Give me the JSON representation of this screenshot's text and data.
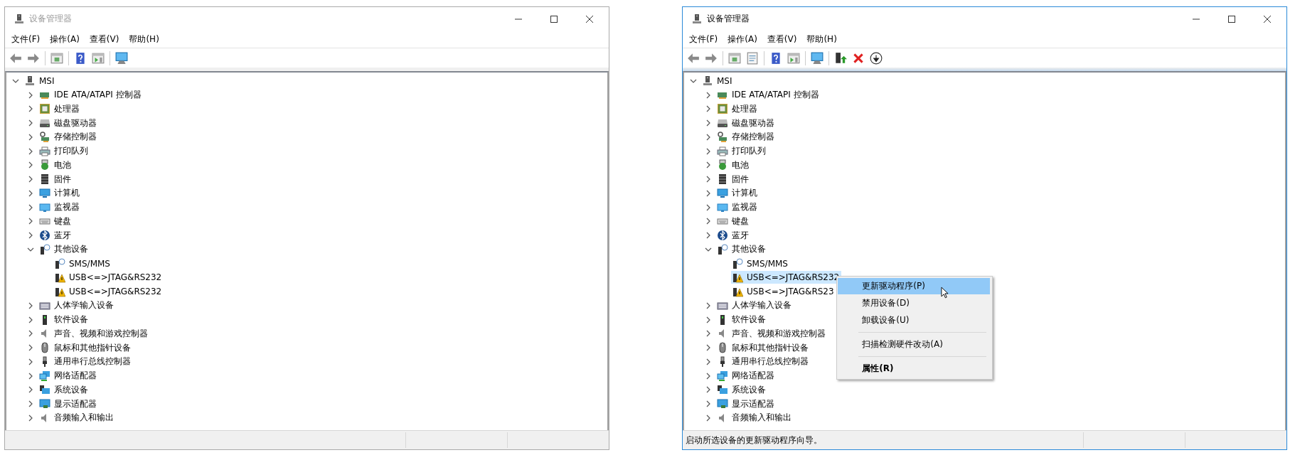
{
  "windows": [
    {
      "title": "设备管理器",
      "active": false,
      "menu": [
        "文件(F)",
        "操作(A)",
        "查看(V)",
        "帮助(H)"
      ],
      "toolbar": [
        {
          "kind": "back"
        },
        {
          "kind": "forward"
        },
        {
          "kind": "separator"
        },
        {
          "kind": "console"
        },
        {
          "kind": "separator"
        },
        {
          "kind": "help"
        },
        {
          "kind": "pane"
        },
        {
          "kind": "separator"
        },
        {
          "kind": "scan"
        }
      ],
      "tree": {
        "label": "MSI",
        "kind": "computer",
        "expanded": true,
        "selected": false,
        "children": [
          {
            "label": "IDE ATA/ATAPI 控制器",
            "kind": "ide",
            "expanded": false,
            "selected": false
          },
          {
            "label": "处理器",
            "kind": "cpu",
            "expanded": false,
            "selected": false
          },
          {
            "label": "磁盘驱动器",
            "kind": "disk",
            "expanded": false,
            "selected": false
          },
          {
            "label": "存储控制器",
            "kind": "storage",
            "expanded": false,
            "selected": false
          },
          {
            "label": "打印队列",
            "kind": "printer",
            "expanded": false,
            "selected": false
          },
          {
            "label": "电池",
            "kind": "battery",
            "expanded": false,
            "selected": false
          },
          {
            "label": "固件",
            "kind": "firmware",
            "expanded": false,
            "selected": false
          },
          {
            "label": "计算机",
            "kind": "pc",
            "expanded": false,
            "selected": false
          },
          {
            "label": "监视器",
            "kind": "monitor",
            "expanded": false,
            "selected": false
          },
          {
            "label": "键盘",
            "kind": "keyboard",
            "expanded": false,
            "selected": false
          },
          {
            "label": "蓝牙",
            "kind": "bluetooth",
            "expanded": false,
            "selected": false
          },
          {
            "label": "其他设备",
            "kind": "unknown",
            "expanded": true,
            "selected": false,
            "children": [
              {
                "label": "SMS/MMS",
                "kind": "unknown",
                "selected": false
              },
              {
                "label": "USB<=>JTAG&RS232",
                "kind": "warning",
                "selected": false
              },
              {
                "label": "USB<=>JTAG&RS232",
                "kind": "warning",
                "selected": false
              }
            ]
          },
          {
            "label": "人体学输入设备",
            "kind": "hid",
            "expanded": false,
            "selected": false
          },
          {
            "label": "软件设备",
            "kind": "software",
            "expanded": false,
            "selected": false
          },
          {
            "label": "声音、视频和游戏控制器",
            "kind": "sound",
            "expanded": false,
            "selected": false
          },
          {
            "label": "鼠标和其他指针设备",
            "kind": "mouse",
            "expanded": false,
            "selected": false
          },
          {
            "label": "通用串行总线控制器",
            "kind": "usb",
            "expanded": false,
            "selected": false
          },
          {
            "label": "网络适配器",
            "kind": "network",
            "expanded": false,
            "selected": false
          },
          {
            "label": "系统设备",
            "kind": "system",
            "expanded": false,
            "selected": false
          },
          {
            "label": "显示适配器",
            "kind": "display",
            "expanded": false,
            "selected": false
          },
          {
            "label": "音频输入和输出",
            "kind": "sound",
            "expanded": false,
            "selected": false
          }
        ]
      }
    },
    {
      "title": "设备管理器",
      "active": true,
      "menu": [
        "文件(F)",
        "操作(A)",
        "查看(V)",
        "帮助(H)"
      ],
      "toolbar": [
        {
          "kind": "back"
        },
        {
          "kind": "forward"
        },
        {
          "kind": "separator"
        },
        {
          "kind": "console"
        },
        {
          "kind": "properties"
        },
        {
          "kind": "separator"
        },
        {
          "kind": "help"
        },
        {
          "kind": "pane"
        },
        {
          "kind": "separator"
        },
        {
          "kind": "scan"
        },
        {
          "kind": "separator"
        },
        {
          "kind": "update"
        },
        {
          "kind": "uninstall"
        },
        {
          "kind": "disable"
        }
      ],
      "tree": {
        "label": "MSI",
        "kind": "computer",
        "expanded": true,
        "selected": false,
        "children": [
          {
            "label": "IDE ATA/ATAPI 控制器",
            "kind": "ide",
            "expanded": false,
            "selected": false
          },
          {
            "label": "处理器",
            "kind": "cpu",
            "expanded": false,
            "selected": false
          },
          {
            "label": "磁盘驱动器",
            "kind": "disk",
            "expanded": false,
            "selected": false
          },
          {
            "label": "存储控制器",
            "kind": "storage",
            "expanded": false,
            "selected": false
          },
          {
            "label": "打印队列",
            "kind": "printer",
            "expanded": false,
            "selected": false
          },
          {
            "label": "电池",
            "kind": "battery",
            "expanded": false,
            "selected": false
          },
          {
            "label": "固件",
            "kind": "firmware",
            "expanded": false,
            "selected": false
          },
          {
            "label": "计算机",
            "kind": "pc",
            "expanded": false,
            "selected": false
          },
          {
            "label": "监视器",
            "kind": "monitor",
            "expanded": false,
            "selected": false
          },
          {
            "label": "键盘",
            "kind": "keyboard",
            "expanded": false,
            "selected": false
          },
          {
            "label": "蓝牙",
            "kind": "bluetooth",
            "expanded": false,
            "selected": false
          },
          {
            "label": "其他设备",
            "kind": "unknown",
            "expanded": true,
            "selected": false,
            "children": [
              {
                "label": "SMS/MMS",
                "kind": "unknown",
                "selected": false
              },
              {
                "label": "USB<=>JTAG&RS232",
                "kind": "warning",
                "selected": true
              },
              {
                "label": "USB<=>JTAG&RS23",
                "kind": "warning",
                "selected": false
              }
            ]
          },
          {
            "label": "人体学输入设备",
            "kind": "hid",
            "expanded": false,
            "selected": false
          },
          {
            "label": "软件设备",
            "kind": "software",
            "expanded": false,
            "selected": false
          },
          {
            "label": "声音、视频和游戏控制器",
            "kind": "sound",
            "expanded": false,
            "selected": false
          },
          {
            "label": "鼠标和其他指针设备",
            "kind": "mouse",
            "expanded": false,
            "selected": false
          },
          {
            "label": "通用串行总线控制器",
            "kind": "usb",
            "expanded": false,
            "selected": false
          },
          {
            "label": "网络适配器",
            "kind": "network",
            "expanded": false,
            "selected": false
          },
          {
            "label": "系统设备",
            "kind": "system",
            "expanded": false,
            "selected": false
          },
          {
            "label": "显示适配器",
            "kind": "display",
            "expanded": false,
            "selected": false
          },
          {
            "label": "音频输入和输出",
            "kind": "sound",
            "expanded": false,
            "selected": false
          }
        ]
      },
      "context_menu": [
        {
          "kind": "item",
          "label": "更新驱动程序(P)",
          "selected": true,
          "default": false
        },
        {
          "kind": "item",
          "label": "禁用设备(D)",
          "selected": false,
          "default": false
        },
        {
          "kind": "item",
          "label": "卸载设备(U)",
          "selected": false,
          "default": false
        },
        {
          "kind": "separator"
        },
        {
          "kind": "item",
          "label": "扫描检测硬件改动(A)",
          "selected": false,
          "default": false
        },
        {
          "kind": "separator"
        },
        {
          "kind": "item",
          "label": "属性(R)",
          "selected": false,
          "default": true
        }
      ],
      "status_bar": {
        "text": "启动所选设备的更新驱动程序向导。"
      }
    }
  ]
}
